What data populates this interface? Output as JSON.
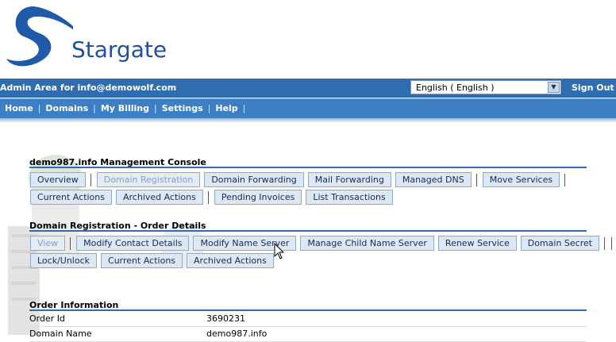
{
  "brand": {
    "name": "Stargate"
  },
  "admin_bar": {
    "label": "Admin Area for info@demowolf.com",
    "language_value": "English ( English )",
    "signout_label": "Sign Out"
  },
  "nav": {
    "items": [
      "Home",
      "Domains",
      "My Billing",
      "Settings",
      "Help"
    ]
  },
  "console": {
    "title": "demo987.info Management Console",
    "row1": [
      "Overview",
      "Domain Registration",
      "Domain Forwarding",
      "Mail Forwarding",
      "Managed DNS",
      "Move Services"
    ],
    "row2": [
      "Current Actions",
      "Archived Actions",
      "Pending Invoices",
      "List Transactions"
    ]
  },
  "order_details": {
    "title": "Domain Registration - Order Details",
    "row1": [
      "View",
      "Modify Contact Details",
      "Modify Name Server",
      "Manage Child Name Server",
      "Renew Service",
      "Domain Secret"
    ],
    "row2": [
      "Lock/Unlock",
      "Current Actions",
      "Archived Actions"
    ]
  },
  "order_info": {
    "title": "Order Information",
    "rows": [
      {
        "label": "Order Id",
        "value": "3690231"
      },
      {
        "label": "Domain Name",
        "value": "demo987.info"
      }
    ]
  },
  "colors": {
    "bar": "#2f6cb0",
    "nav": "#3d7fc4",
    "button_bg": "#dde8f5",
    "brand_text": "#1f4f9e"
  }
}
